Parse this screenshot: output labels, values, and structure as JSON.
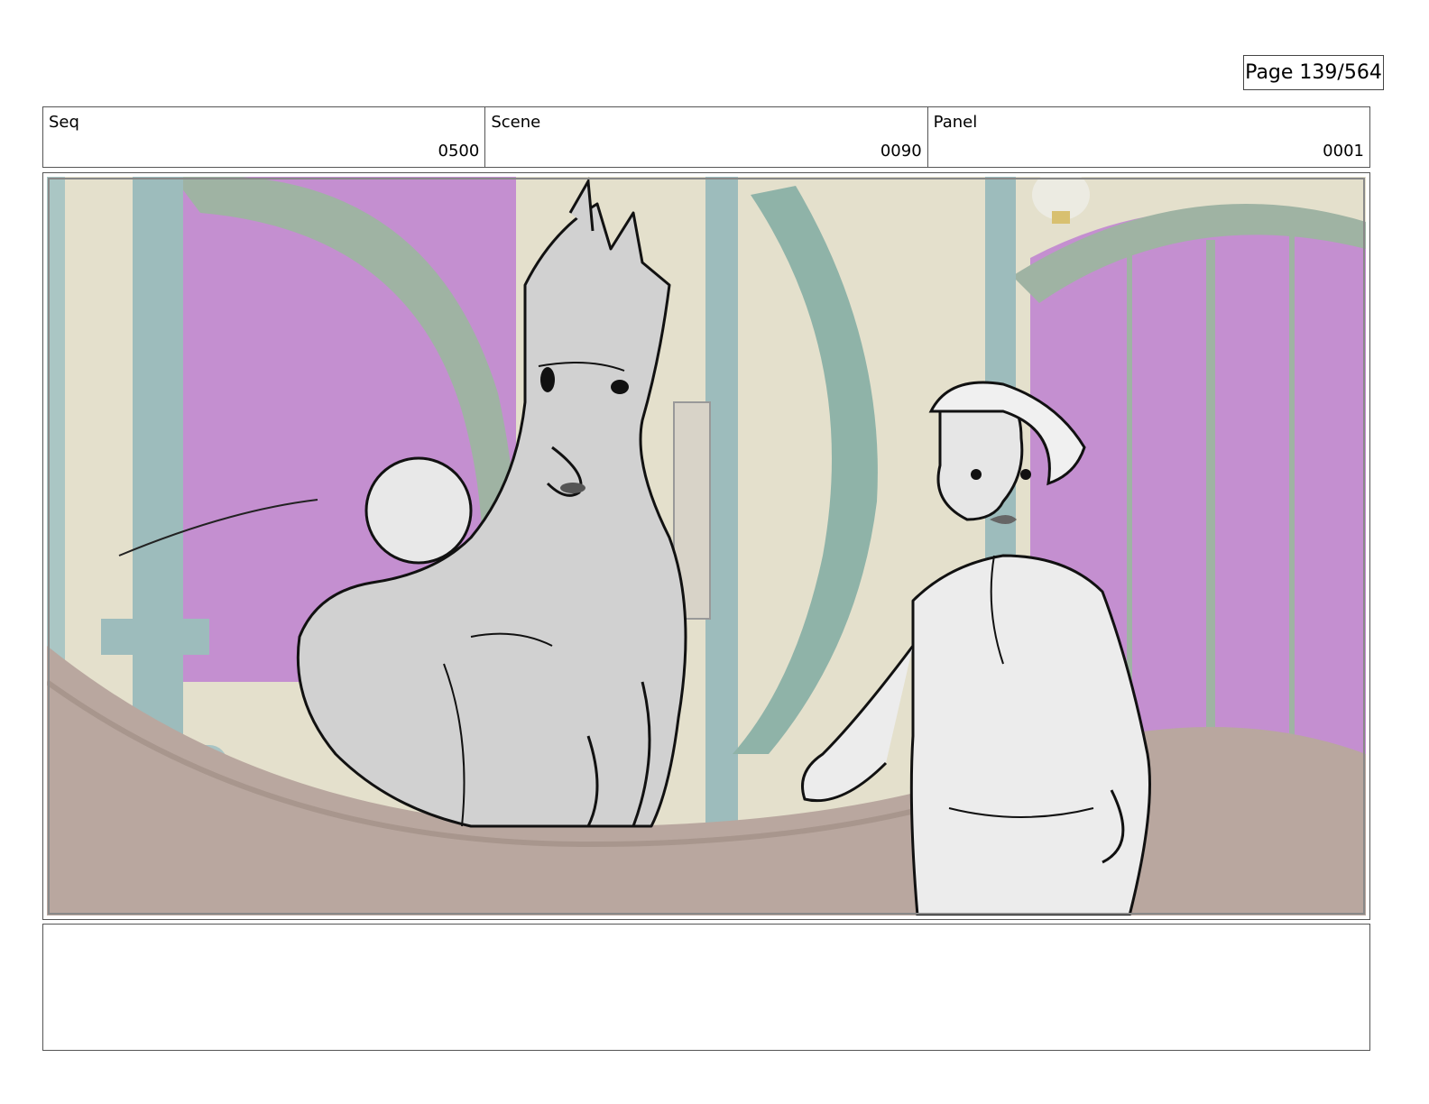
{
  "page": {
    "label": "Page 139/564"
  },
  "header": {
    "seq": {
      "label": "Seq",
      "value": "0500"
    },
    "scene": {
      "label": "Scene",
      "value": "0090"
    },
    "panel": {
      "label": "Panel",
      "value": "0001"
    }
  },
  "colors": {
    "window_purple": "#c48fd0",
    "arch_green": "#9fb3a3",
    "pillar_blue": "#9dbcbc",
    "wall_cream": "#e4e0cc",
    "floor_brown": "#b9a79f",
    "sketch_gray": "#d1d1d1",
    "line_black": "#111111"
  },
  "notes": {
    "text": ""
  }
}
